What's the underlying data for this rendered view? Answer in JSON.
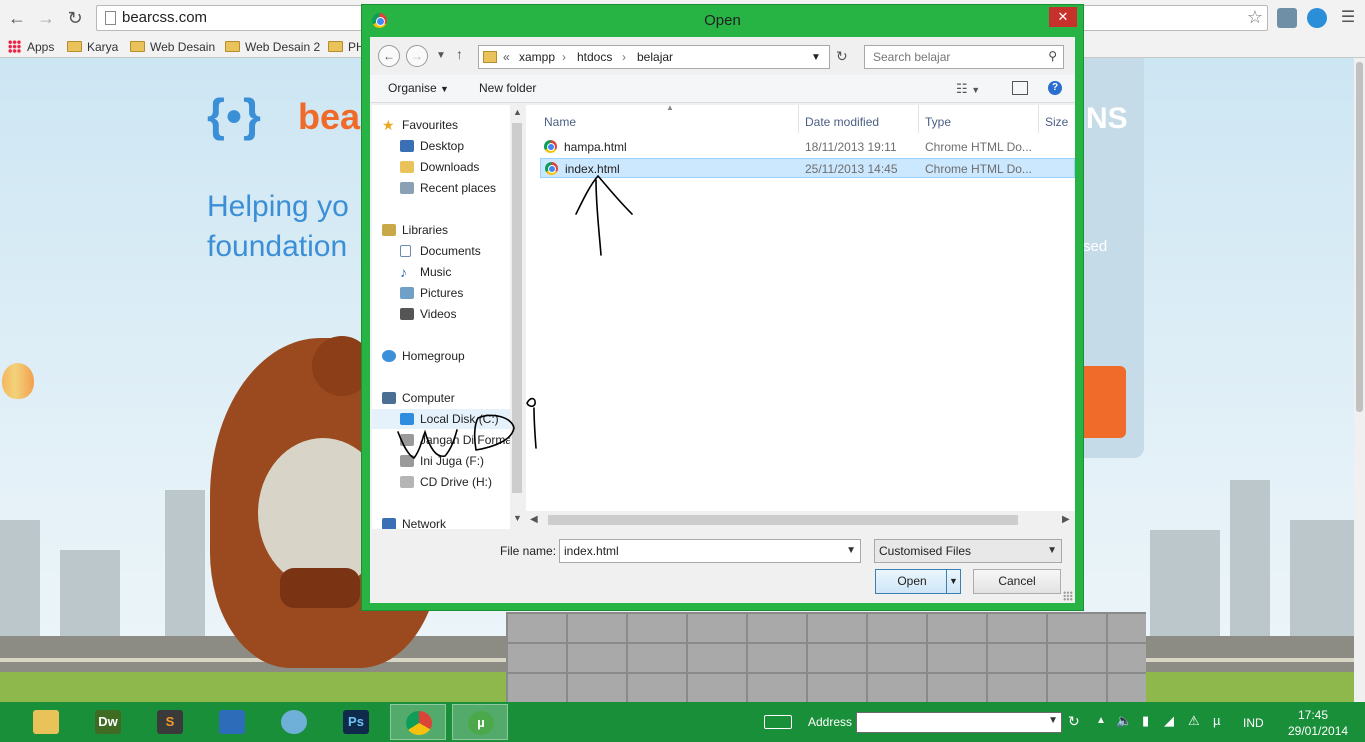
{
  "browser": {
    "url": "bearcss.com",
    "bookmarks": [
      "Apps",
      "Karya",
      "Web Desain",
      "Web Desain 2",
      "PH"
    ]
  },
  "site": {
    "logo_brace": "{",
    "logo_text": "bea",
    "tagline_line1": "Helping yo",
    "tagline_line2": "foundation",
    "right_title": "NS",
    "right_small": "sed"
  },
  "dialog": {
    "title": "Open",
    "close_label": "✕",
    "path": {
      "prefix": "«",
      "crumbs": [
        "xampp",
        "htdocs",
        "belajar"
      ]
    },
    "search_placeholder": "Search belajar",
    "toolbar": {
      "organise": "Organise",
      "new_folder": "New folder"
    },
    "nav": {
      "favourites": "Favourites",
      "desktop": "Desktop",
      "downloads": "Downloads",
      "recent": "Recent places",
      "libraries": "Libraries",
      "documents": "Documents",
      "music": "Music",
      "pictures": "Pictures",
      "videos": "Videos",
      "homegroup": "Homegroup",
      "computer": "Computer",
      "local_disk": "Local Disk (C:)",
      "jangan": "Jangan Di Forma",
      "ini_juga": "Ini Juga (F:)",
      "cd_drive": "CD Drive (H:)",
      "network": "Network"
    },
    "columns": {
      "name": "Name",
      "date": "Date modified",
      "type": "Type",
      "size": "Size"
    },
    "files": [
      {
        "name": "hampa.html",
        "date": "18/11/2013 19:11",
        "type": "Chrome HTML Do..."
      },
      {
        "name": "index.html",
        "date": "25/11/2013 14:45",
        "type": "Chrome HTML Do..."
      }
    ],
    "file_name_label": "File name:",
    "file_name_value": "index.html",
    "filter_value": "Customised Files",
    "open_label": "Open",
    "cancel_label": "Cancel"
  },
  "taskbar": {
    "apps": [
      "Dw",
      "Ps"
    ],
    "address_label": "Address",
    "language": "IND",
    "time": "17:45",
    "date": "29/01/2014"
  }
}
